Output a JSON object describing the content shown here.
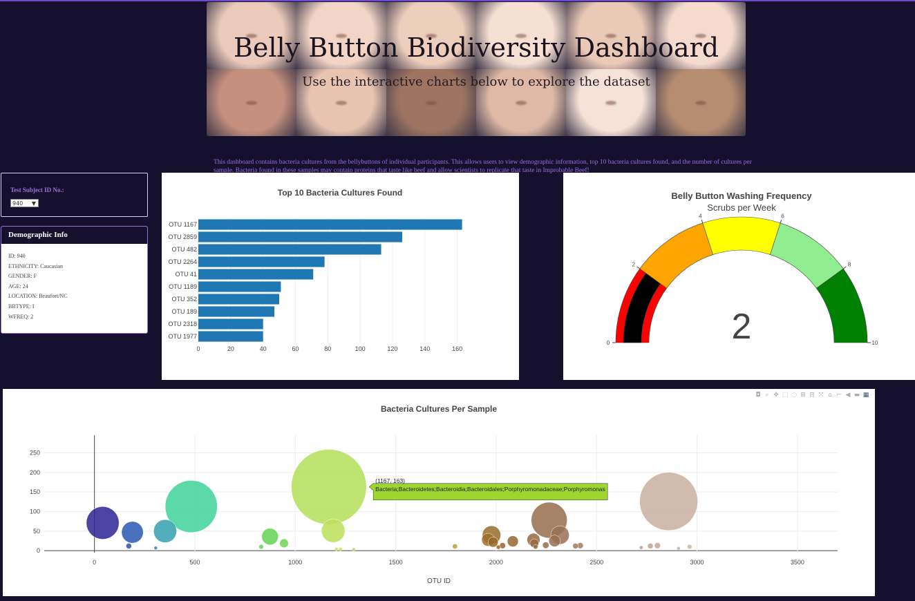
{
  "header": {
    "title": "Belly Button Biodiversity Dashboard",
    "subtitle": "Use the interactive charts below to explore the dataset"
  },
  "intro_text": "This dashboard contains bacteria cultures from the bellybuttons of individual participants. This allows users to view demographic information, top 10 bacteria cultures found, and the number of cultures per sample. Bacteria found in these samples may contain proteins that taste like beef and allow scientists to replicate that taste in Improbable Beef!",
  "selector": {
    "label": "Test Subject ID No.:",
    "value": "940"
  },
  "demographics": {
    "title": "Demographic Info",
    "rows": [
      "ID: 940",
      "ETHNICITY: Caucasian",
      "GENDER: F",
      "AGE: 24",
      "LOCATION: Beaufort/NC",
      "BBTYPE: I",
      "WFREQ: 2"
    ]
  },
  "colors": {
    "page_bg": "#15102d",
    "accent": "#9b6fe0",
    "bar": "#1f77b4",
    "gauge": [
      "#ff0000",
      "#ffa500",
      "#ffff00",
      "#90ee90",
      "#008000"
    ],
    "gauge_needle": "#000000"
  },
  "icons": [
    "camera-icon",
    "zoom-icon",
    "pan-icon",
    "box-select-icon",
    "lasso-icon",
    "zoom-in-icon",
    "zoom-out-icon",
    "autoscale-icon",
    "reset-axes-icon",
    "spike-lines-icon",
    "hover-closest-icon",
    "hover-compare-icon",
    "plotly-logo-icon"
  ],
  "chart_data": [
    {
      "type": "bar",
      "orientation": "horizontal",
      "title": "Top 10 Bacteria Cultures Found",
      "categories": [
        "OTU 1167",
        "OTU 2859",
        "OTU 482",
        "OTU 2264",
        "OTU 41",
        "OTU 1189",
        "OTU 352",
        "OTU 189",
        "OTU 2318",
        "OTU 1977"
      ],
      "values": [
        163,
        126,
        113,
        78,
        71,
        51,
        50,
        47,
        40,
        40
      ],
      "xlim": [
        0,
        170
      ],
      "xticks": [
        0,
        20,
        40,
        60,
        80,
        100,
        120,
        140,
        160
      ]
    },
    {
      "type": "gauge",
      "title": "Belly Button Washing Frequency",
      "subtitle": "Scrubs per Week",
      "value": 2,
      "range": [
        0,
        10
      ],
      "ticks": [
        0,
        2,
        4,
        6,
        8,
        10
      ],
      "steps": [
        [
          0,
          2
        ],
        [
          2,
          4
        ],
        [
          4,
          6
        ],
        [
          6,
          8
        ],
        [
          8,
          10
        ]
      ]
    },
    {
      "type": "scatter",
      "title": "Bacteria Cultures Per Sample",
      "xlabel": "OTU ID",
      "xlim": [
        -250,
        3700
      ],
      "ylim": [
        -5,
        295
      ],
      "xticks": [
        0,
        500,
        1000,
        1500,
        2000,
        2500,
        3000,
        3500
      ],
      "yticks": [
        0,
        50,
        100,
        150,
        200,
        250
      ],
      "points": [
        {
          "x": 41,
          "y": 71
        },
        {
          "x": 171,
          "y": 12
        },
        {
          "x": 189,
          "y": 47
        },
        {
          "x": 305,
          "y": 7
        },
        {
          "x": 352,
          "y": 50
        },
        {
          "x": 482,
          "y": 113
        },
        {
          "x": 830,
          "y": 10
        },
        {
          "x": 874,
          "y": 36
        },
        {
          "x": 944,
          "y": 19
        },
        {
          "x": 1167,
          "y": 163
        },
        {
          "x": 1189,
          "y": 51
        },
        {
          "x": 1205,
          "y": 4
        },
        {
          "x": 1225,
          "y": 4
        },
        {
          "x": 1291,
          "y": 3
        },
        {
          "x": 1795,
          "y": 11
        },
        {
          "x": 1960,
          "y": 28
        },
        {
          "x": 1977,
          "y": 40
        },
        {
          "x": 1985,
          "y": 22
        },
        {
          "x": 2011,
          "y": 9
        },
        {
          "x": 2032,
          "y": 13
        },
        {
          "x": 2083,
          "y": 24
        },
        {
          "x": 2186,
          "y": 28
        },
        {
          "x": 2190,
          "y": 19
        },
        {
          "x": 2196,
          "y": 10
        },
        {
          "x": 2247,
          "y": 14
        },
        {
          "x": 2264,
          "y": 78
        },
        {
          "x": 2291,
          "y": 25
        },
        {
          "x": 2318,
          "y": 40
        },
        {
          "x": 2395,
          "y": 12
        },
        {
          "x": 2419,
          "y": 13
        },
        {
          "x": 2722,
          "y": 8
        },
        {
          "x": 2768,
          "y": 12
        },
        {
          "x": 2803,
          "y": 13
        },
        {
          "x": 2859,
          "y": 126
        },
        {
          "x": 2908,
          "y": 6
        },
        {
          "x": 2963,
          "y": 10
        }
      ],
      "tooltip": {
        "coords": "(1167, 163)",
        "text": "Bacteria;Bacteroidetes;Bacteroidia;Bacteroidales;Porphyromonadaceae;Porphyromonas"
      }
    }
  ]
}
